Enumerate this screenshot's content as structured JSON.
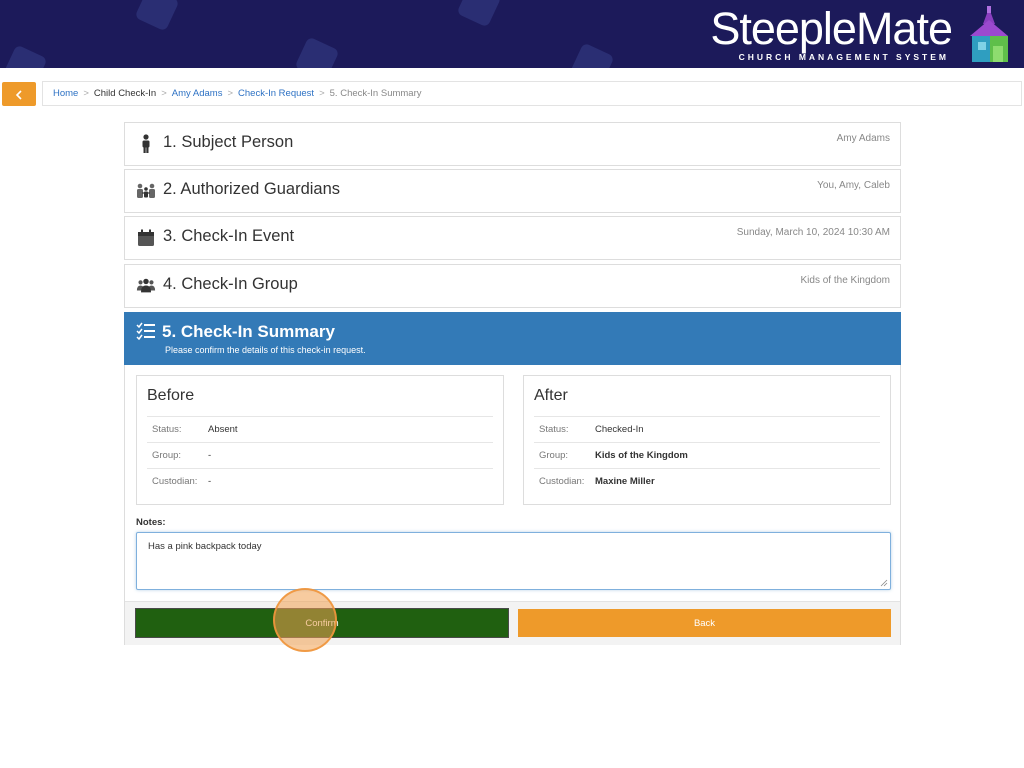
{
  "header": {
    "brand_title": "SteepleMate",
    "brand_subtitle": "CHURCH MANAGEMENT SYSTEM",
    "background": "#1c1a5a"
  },
  "breadcrumb": {
    "back_icon": "chevron-left-icon",
    "items": [
      "Home",
      "Child Check-In",
      "Amy Adams",
      "Check-In Request",
      "5. Check-In Summary"
    ],
    "separator": ">"
  },
  "steps": [
    {
      "icon": "person-icon",
      "title": "1. Subject Person",
      "value": "Amy Adams"
    },
    {
      "icon": "guardians-icon",
      "title": "2. Authorized Guardians",
      "value": "You, Amy, Caleb"
    },
    {
      "icon": "calendar-icon",
      "title": "3. Check-In Event",
      "value": "Sunday, March 10, 2024 10:30 AM"
    },
    {
      "icon": "group-icon",
      "title": "4. Check-In Group",
      "value": "Kids of the Kingdom"
    }
  ],
  "summary": {
    "icon": "checklist-icon",
    "title": "5. Check-In Summary",
    "subtitle": "Please confirm the details of this check-in request.",
    "accent": "#337ab7",
    "before": {
      "title": "Before",
      "rows": [
        {
          "label": "Status:",
          "value": "Absent"
        },
        {
          "label": "Group:",
          "value": "-"
        },
        {
          "label": "Custodian:",
          "value": "-"
        }
      ]
    },
    "after": {
      "title": "After",
      "rows": [
        {
          "label": "Status:",
          "value": "Checked-In"
        },
        {
          "label": "Group:",
          "value": "Kids of the Kingdom"
        },
        {
          "label": "Custodian:",
          "value": "Maxine Miller"
        }
      ]
    },
    "notes_label": "Notes:",
    "notes_value": "Has a pink backpack today",
    "confirm_label": "Confirm",
    "back_label": "Back",
    "confirm_color": "#206010",
    "back_color": "#ee9a2a"
  }
}
